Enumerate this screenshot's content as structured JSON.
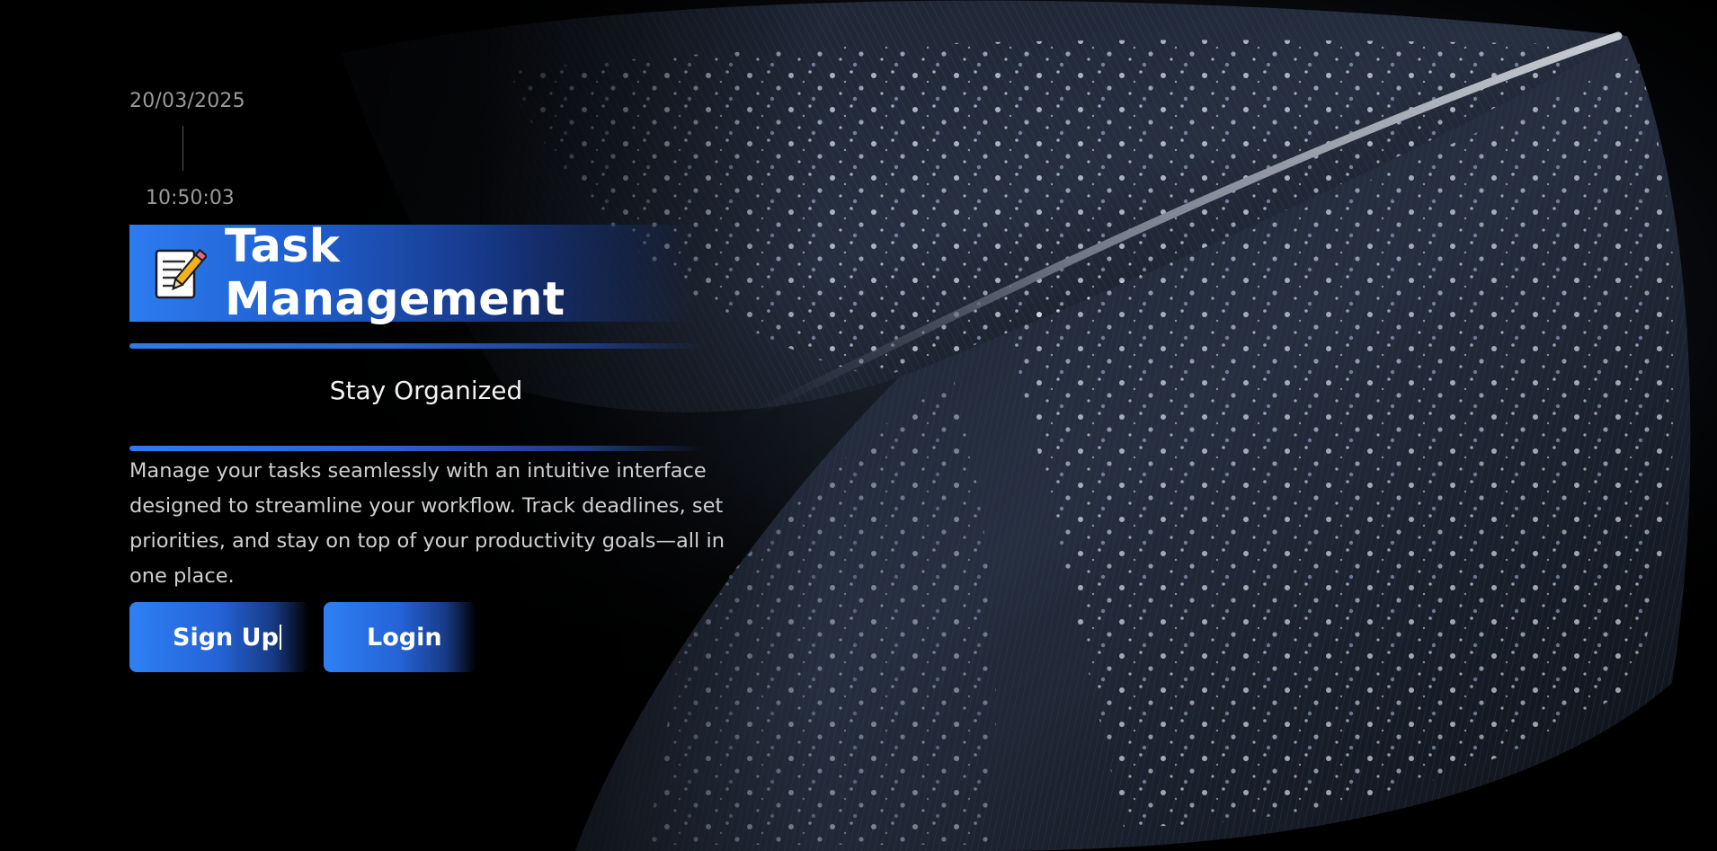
{
  "header": {
    "date": "20/03/2025",
    "time": "10:50:03"
  },
  "hero": {
    "icon": "memo-icon",
    "title": "Task Management",
    "subtitle": "Stay Organized",
    "description": "Manage your tasks seamlessly with an intuitive interface designed to streamline your workflow. Track deadlines, set priorities, and stay on top of your productivity goals—all in one place."
  },
  "actions": {
    "signup_label": "Sign Up",
    "login_label": "Login"
  },
  "colors": {
    "accent": "#2f80f5",
    "background": "#000000",
    "text_muted": "#9a9a9a"
  }
}
